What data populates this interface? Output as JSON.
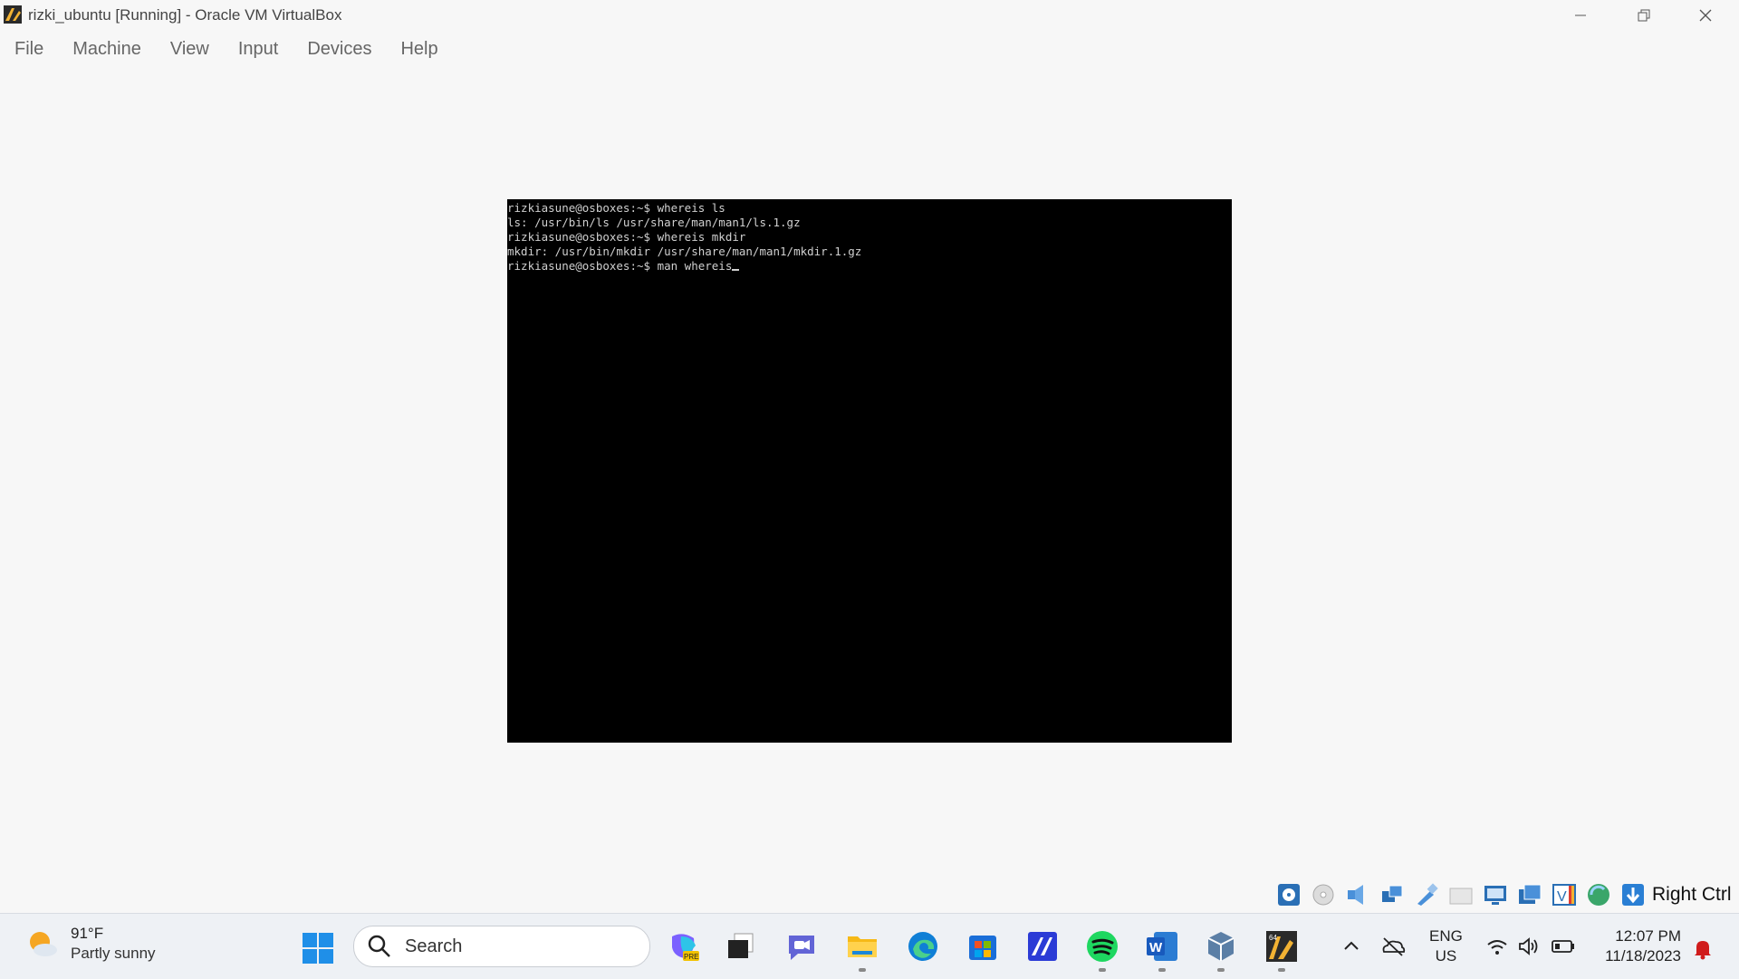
{
  "window": {
    "title": "rizki_ubuntu [Running] - Oracle VM VirtualBox",
    "menu": [
      "File",
      "Machine",
      "View",
      "Input",
      "Devices",
      "Help"
    ]
  },
  "terminal": {
    "lines": [
      "rizkiasune@osboxes:~$ whereis ls",
      "ls: /usr/bin/ls /usr/share/man/man1/ls.1.gz",
      "rizkiasune@osboxes:~$ whereis mkdir",
      "mkdir: /usr/bin/mkdir /usr/share/man/man1/mkdir.1.gz"
    ],
    "current_prompt": "rizkiasune@osboxes:~$ man whereis"
  },
  "statusbar": {
    "icons": [
      "hard-disk-icon",
      "optical-drive-icon",
      "audio-icon",
      "network-icon",
      "usb-icon",
      "shared-folders-icon",
      "display-icon",
      "recording-icon",
      "vt-x-icon",
      "mouse-integration-icon",
      "keyboard-capture-icon"
    ],
    "host_key": "Right Ctrl"
  },
  "taskbar": {
    "weather": {
      "temp": "91°F",
      "condition": "Partly sunny"
    },
    "search_label": "Search",
    "apps": [
      "copilot-icon",
      "task-view-icon",
      "teams-chat-icon",
      "file-explorer-icon",
      "edge-icon",
      "store-icon",
      "app-icon",
      "spotify-icon",
      "word-icon",
      "virtualbox-icon",
      "virtualbox-vm-icon"
    ],
    "lang": {
      "line1": "ENG",
      "line2": "US"
    },
    "clock": {
      "time": "12:07 PM",
      "date": "11/18/2023"
    }
  },
  "colors": {
    "terminal_bg": "#000000",
    "terminal_fg": "#d0d0d0",
    "window_bg": "#f7f7f7",
    "taskbar_bg": "#eef1f5"
  }
}
